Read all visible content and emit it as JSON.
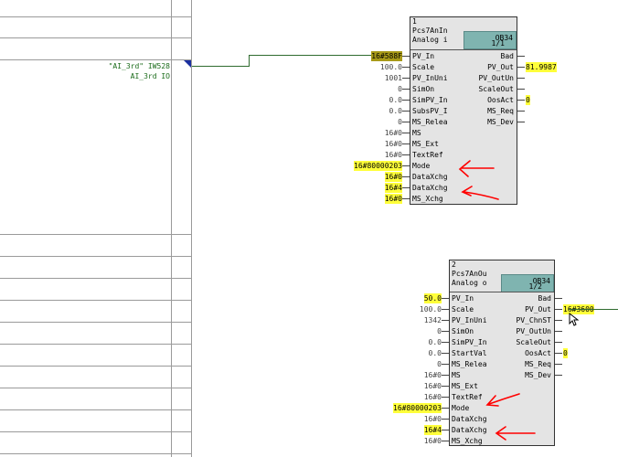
{
  "signal": {
    "name": "\"AI_3rd\" IW528",
    "comment": "AI_3rd IO"
  },
  "blocks": [
    {
      "number": "1",
      "type": "Pcs7AnIn",
      "comment": "Analog i",
      "ob": "OB34",
      "page": "1/1",
      "inputs": [
        {
          "name": "PV_In",
          "value": "16#588F",
          "highlight": "dark"
        },
        {
          "name": "Scale",
          "value": "100.0"
        },
        {
          "name": "PV_InUni",
          "value": "1001"
        },
        {
          "name": "SimOn",
          "value": "0"
        },
        {
          "name": "SimPV_In",
          "value": "0.0"
        },
        {
          "name": "SubsPV_I",
          "value": "0.0"
        },
        {
          "name": "MS_Relea",
          "value": "0"
        },
        {
          "name": "MS",
          "value": "16#0"
        },
        {
          "name": "MS_Ext",
          "value": "16#0"
        },
        {
          "name": "TextRef",
          "value": "16#0"
        },
        {
          "name": "Mode",
          "value": "16#80000203",
          "highlight": "yellow"
        },
        {
          "name": "DataXchg",
          "value": "16#0",
          "highlight": "yellow"
        },
        {
          "name": "DataXchg",
          "value": "16#4",
          "highlight": "yellow"
        },
        {
          "name": "MS_Xchg",
          "value": "16#0",
          "highlight": "yellow"
        }
      ],
      "outputs": [
        {
          "name": "Bad",
          "value": ""
        },
        {
          "name": "PV_Out",
          "value": "81.9987",
          "highlight": "yellow"
        },
        {
          "name": "PV_OutUn",
          "value": ""
        },
        {
          "name": "ScaleOut",
          "value": ""
        },
        {
          "name": "OosAct",
          "value": "0",
          "highlight": "yellow"
        },
        {
          "name": "MS_Req",
          "value": ""
        },
        {
          "name": "MS_Dev",
          "value": ""
        }
      ]
    },
    {
      "number": "2",
      "type": "Pcs7AnOu",
      "comment": "Analog o",
      "ob": "OB34",
      "page": "1/2",
      "inputs": [
        {
          "name": "PV_In",
          "value": "50.0",
          "highlight": "yellow"
        },
        {
          "name": "Scale",
          "value": "100.0"
        },
        {
          "name": "PV_InUni",
          "value": "1342"
        },
        {
          "name": "SimOn",
          "value": "0"
        },
        {
          "name": "SimPV_In",
          "value": "0.0"
        },
        {
          "name": "StartVal",
          "value": "0.0"
        },
        {
          "name": "MS_Relea",
          "value": "0"
        },
        {
          "name": "MS",
          "value": "16#0"
        },
        {
          "name": "MS_Ext",
          "value": "16#0"
        },
        {
          "name": "TextRef",
          "value": "16#0"
        },
        {
          "name": "Mode",
          "value": "16#80000203",
          "highlight": "yellow"
        },
        {
          "name": "DataXchg",
          "value": "16#0"
        },
        {
          "name": "DataXchg",
          "value": "16#4",
          "highlight": "yellow"
        },
        {
          "name": "MS_Xchg",
          "value": "16#0"
        }
      ],
      "outputs": [
        {
          "name": "Bad",
          "value": ""
        },
        {
          "name": "PV_Out",
          "value": "16#3600",
          "highlight": "yellow"
        },
        {
          "name": "PV_ChnST",
          "value": ""
        },
        {
          "name": "PV_OutUn",
          "value": ""
        },
        {
          "name": "ScaleOut",
          "value": ""
        },
        {
          "name": "OosAct",
          "value": "0",
          "highlight": "yellow"
        },
        {
          "name": "MS_Req",
          "value": ""
        },
        {
          "name": "MS_Dev",
          "value": ""
        }
      ]
    }
  ],
  "colors": {
    "highlight": "#ffff3a",
    "ob_box": "#7fb4b0",
    "wire": "#2f6b2f",
    "annotation": "#ff0000"
  },
  "icons": [
    "arrow-marker-icon",
    "mouse-cursor-icon"
  ]
}
